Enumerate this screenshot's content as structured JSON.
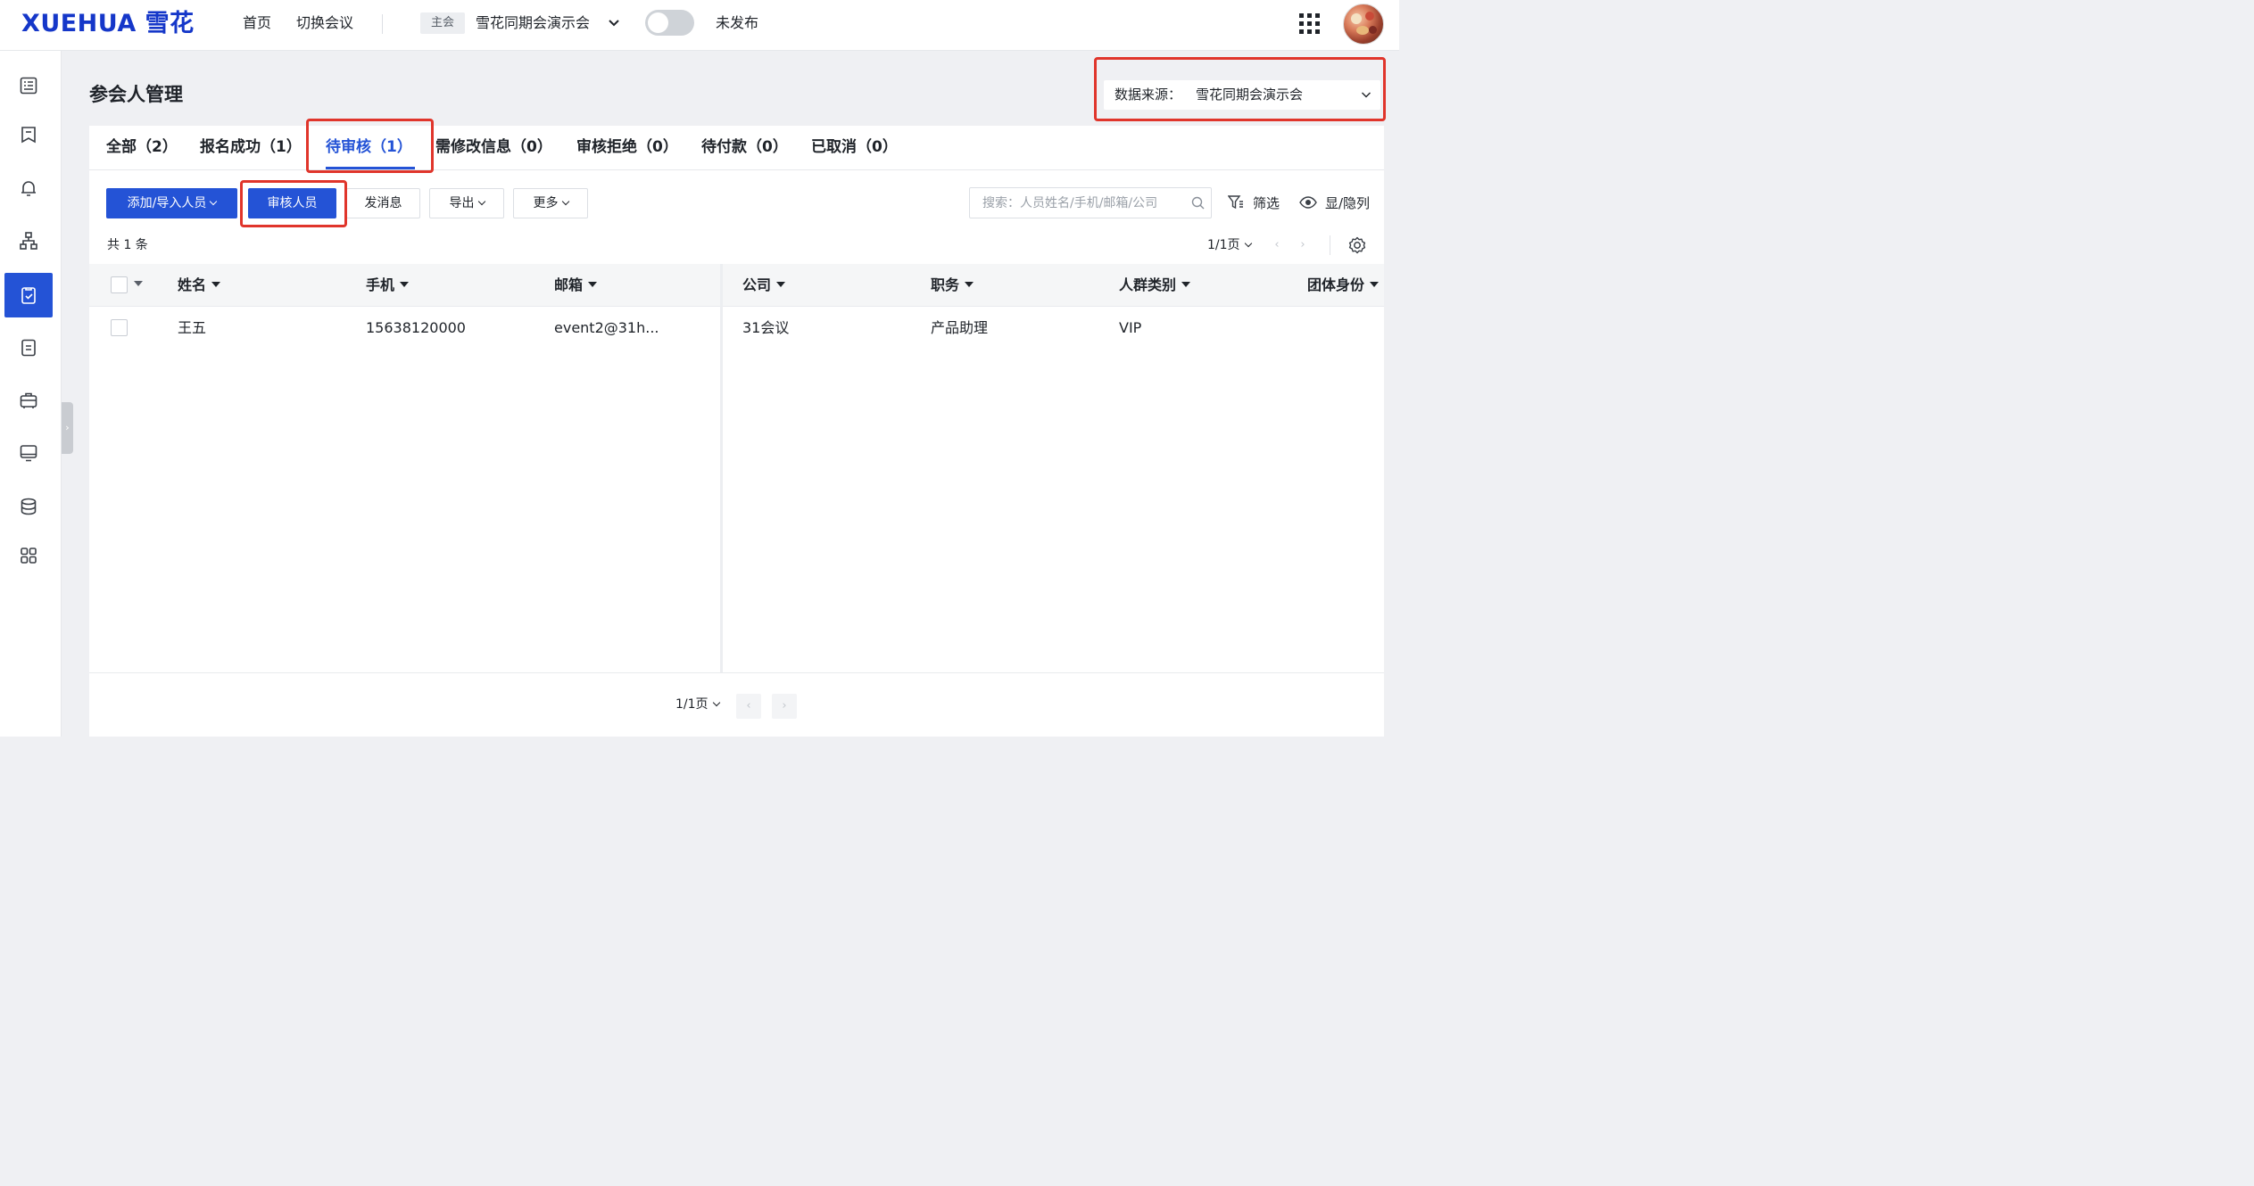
{
  "topbar": {
    "logo": "XUEHUA 雪花",
    "nav": [
      "首页",
      "切换会议"
    ],
    "conference_tag": "主会",
    "conference_name": "雪花同期会演示会",
    "publish_status": "未发布"
  },
  "sidebar": {
    "icons": [
      "dashboard-icon",
      "bookmark-icon",
      "bell-icon",
      "org-tree-icon",
      "checklist-icon",
      "document-icon",
      "briefcase-icon",
      "monitor-icon",
      "database-icon",
      "grid-icon"
    ],
    "active_index": 4
  },
  "page": {
    "title": "参会人管理",
    "source_label": "数据来源：",
    "source_value": "雪花同期会演示会"
  },
  "tabs": [
    {
      "label": "全部（2）"
    },
    {
      "label": "报名成功（1）"
    },
    {
      "label": "待审核（1）",
      "active": true
    },
    {
      "label": "需修改信息（0）"
    },
    {
      "label": "审核拒绝（0）"
    },
    {
      "label": "待付款（0）"
    },
    {
      "label": "已取消（0）"
    }
  ],
  "toolbar": {
    "add_import": "添加/导入人员",
    "review": "审核人员",
    "message": "发消息",
    "export": "导出",
    "more": "更多",
    "search_placeholder": "搜索：人员姓名/手机/邮箱/公司",
    "filter": "筛选",
    "columns": "显/隐列"
  },
  "summary": {
    "total": "共 1 条",
    "page_top": "1/1页",
    "page_bottom": "1/1页"
  },
  "table": {
    "columns": [
      "姓名",
      "手机",
      "邮箱",
      "公司",
      "职务",
      "人群类别",
      "团体身份"
    ],
    "rows": [
      [
        "王五",
        "15638120000",
        "event2@31h...",
        "31会议",
        "产品助理",
        "VIP",
        ""
      ]
    ]
  },
  "colors": {
    "primary": "#2453d6",
    "highlight": "#e0352b",
    "logo": "#1537c9"
  }
}
